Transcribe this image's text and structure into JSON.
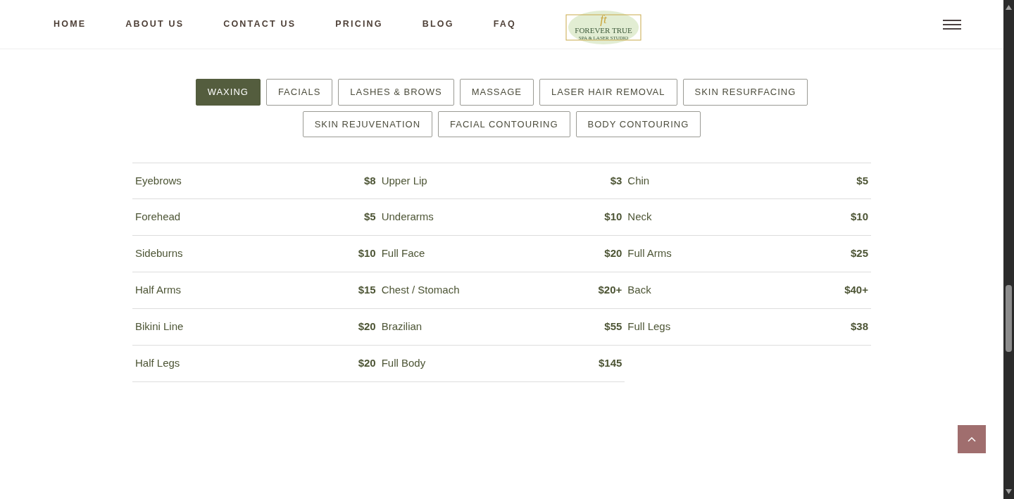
{
  "nav": {
    "links": [
      {
        "label": "HOME"
      },
      {
        "label": "ABOUT US"
      },
      {
        "label": "CONTACT US"
      },
      {
        "label": "PRICING"
      },
      {
        "label": "BLOG"
      },
      {
        "label": "FAQ"
      }
    ],
    "logo": {
      "monogram": "ft",
      "name": "FOREVER TRUE",
      "tagline": "SPA & LASER STUDIO"
    }
  },
  "tabs": [
    {
      "label": "WAXING",
      "selected": true
    },
    {
      "label": "FACIALS",
      "selected": false
    },
    {
      "label": "LASHES & BROWS",
      "selected": false
    },
    {
      "label": "MASSAGE",
      "selected": false
    },
    {
      "label": "LASER HAIR REMOVAL",
      "selected": false
    },
    {
      "label": "SKIN RESURFACING",
      "selected": false
    },
    {
      "label": "SKIN REJUVENATION",
      "selected": false
    },
    {
      "label": "FACIAL CONTOURING",
      "selected": false
    },
    {
      "label": "BODY CONTOURING",
      "selected": false
    }
  ],
  "price_rows": [
    [
      {
        "name": "Eyebrows",
        "price": "$8"
      },
      {
        "name": "Upper Lip",
        "price": "$3"
      },
      {
        "name": "Chin",
        "price": "$5"
      }
    ],
    [
      {
        "name": "Forehead",
        "price": "$5"
      },
      {
        "name": "Underarms",
        "price": "$10"
      },
      {
        "name": "Neck",
        "price": "$10"
      }
    ],
    [
      {
        "name": "Sideburns",
        "price": "$10"
      },
      {
        "name": "Full Face",
        "price": "$20"
      },
      {
        "name": "Full Arms",
        "price": "$25"
      }
    ],
    [
      {
        "name": "Half Arms",
        "price": "$15"
      },
      {
        "name": "Chest / Stomach",
        "price": "$20+"
      },
      {
        "name": "Back",
        "price": "$40+"
      }
    ],
    [
      {
        "name": "Bikini Line",
        "price": "$20"
      },
      {
        "name": "Brazilian",
        "price": "$55"
      },
      {
        "name": "Full Legs",
        "price": "$38"
      }
    ],
    [
      {
        "name": "Half Legs",
        "price": "$20"
      },
      {
        "name": "Full Body",
        "price": "$145"
      }
    ]
  ]
}
